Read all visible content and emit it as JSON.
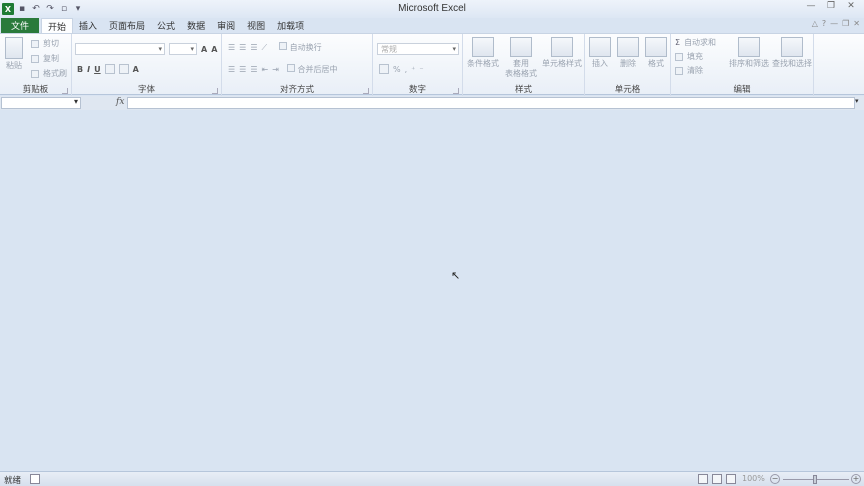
{
  "window": {
    "title": "Microsoft Excel"
  },
  "qat": {
    "icons": [
      "excel-logo-icon",
      "save-icon",
      "undo-icon",
      "redo-icon",
      "print-preview-icon",
      "customize-icon"
    ]
  },
  "tabs": [
    {
      "label": "文件"
    },
    {
      "label": "开始"
    },
    {
      "label": "插入"
    },
    {
      "label": "页面布局"
    },
    {
      "label": "公式"
    },
    {
      "label": "数据"
    },
    {
      "label": "审阅"
    },
    {
      "label": "视图"
    },
    {
      "label": "加载项"
    }
  ],
  "ribbon": {
    "clipboard": {
      "label": "剪贴板",
      "paste": "粘贴",
      "cut": "剪切",
      "copy": "复制",
      "format_painter": "格式刷"
    },
    "font": {
      "label": "字体",
      "bold": "B",
      "italic": "I",
      "underline": "U"
    },
    "alignment": {
      "label": "对齐方式",
      "wrap": "自动换行",
      "merge": "合并后居中"
    },
    "number": {
      "label": "数字",
      "format": "常规",
      "percent": "%"
    },
    "styles": {
      "label": "样式",
      "conditional": "条件格式",
      "table_line1": "套用",
      "table_line2": "表格格式",
      "cell_styles": "单元格样式"
    },
    "cells": {
      "label": "单元格",
      "insert": "插入",
      "delete": "删除",
      "format": "格式"
    },
    "editing": {
      "label": "编辑",
      "autosum": "自动求和",
      "fill": "填充",
      "clear": "清除",
      "sort": "排序和筛选",
      "find": "查找和选择"
    }
  },
  "formula_bar": {
    "fx": "fx"
  },
  "status": {
    "text": "就绪",
    "zoom": "100%"
  }
}
